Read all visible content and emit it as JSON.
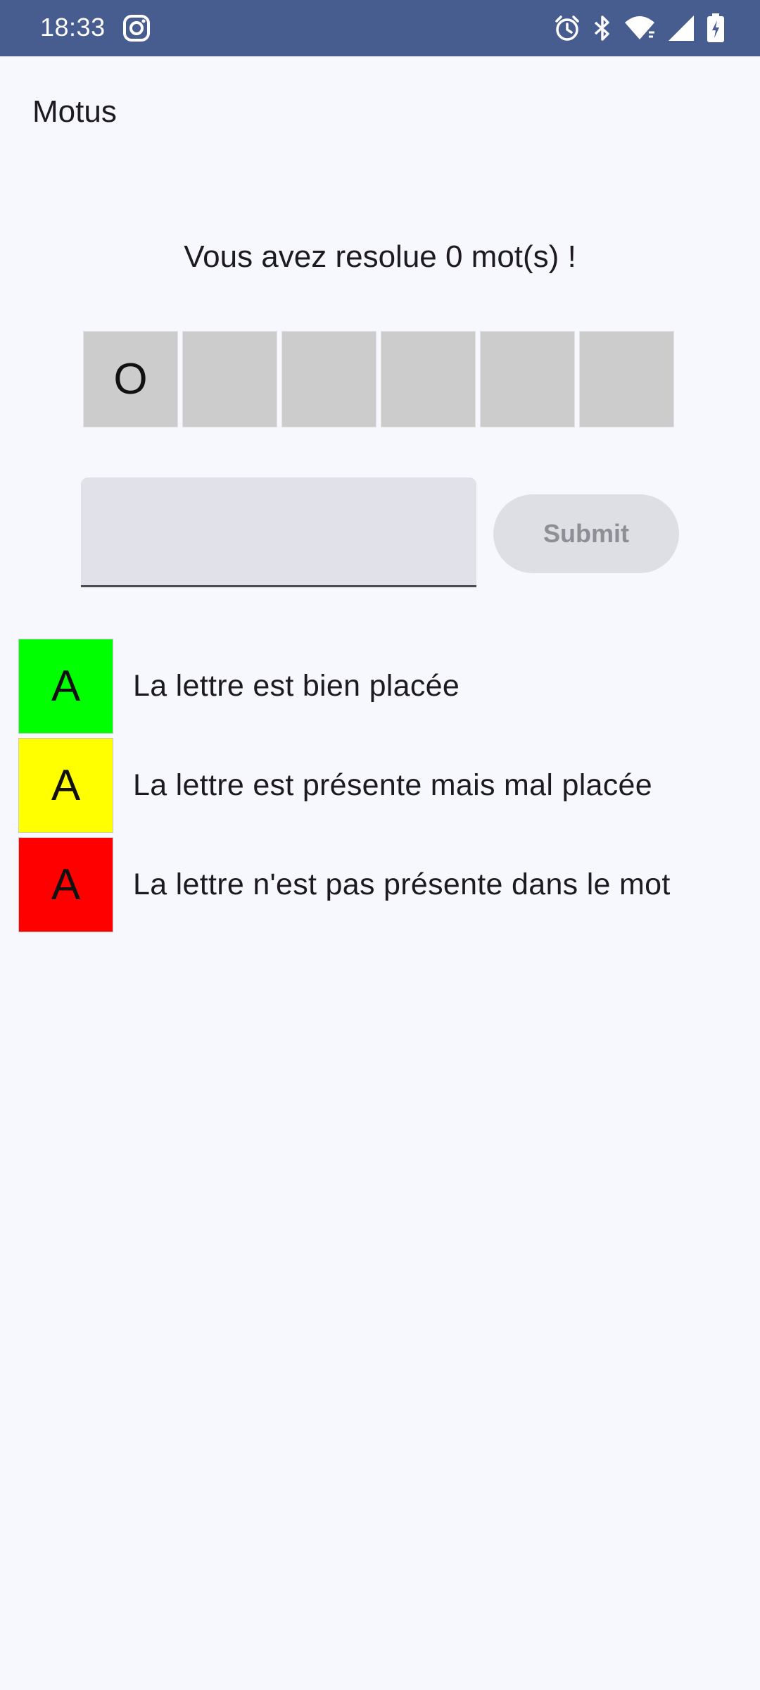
{
  "status_bar": {
    "time": "18:33",
    "background": "#475c8f",
    "icons": [
      "instagram-icon",
      "alarm-icon",
      "bluetooth-icon",
      "wifi-icon",
      "signal-icon",
      "battery-charging-icon"
    ]
  },
  "app": {
    "title": "Motus"
  },
  "score": {
    "text": "Vous avez resolue 0 mot(s) !"
  },
  "grid": {
    "cells": [
      "O",
      "",
      "",
      "",
      "",
      ""
    ],
    "cell_color": "#cccccc"
  },
  "guess": {
    "value": "",
    "placeholder": ""
  },
  "submit": {
    "label": "Submit",
    "enabled": false
  },
  "legend": {
    "items": [
      {
        "letter": "A",
        "color": "#00ff00",
        "text": "La lettre est bien placée"
      },
      {
        "letter": "A",
        "color": "#ffff00",
        "text": "La lettre est présente mais mal placée"
      },
      {
        "letter": "A",
        "color": "#ff0000",
        "text": "La lettre n'est pas présente dans le mot"
      }
    ]
  }
}
